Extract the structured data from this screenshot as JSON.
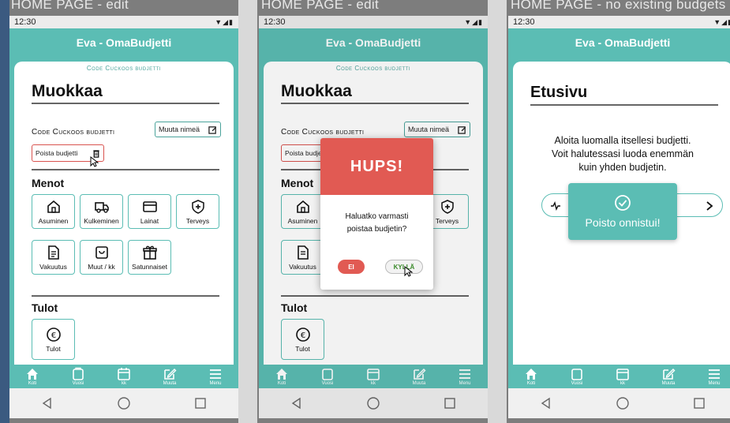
{
  "frames": [
    {
      "title": "HOME PAGE - edit"
    },
    {
      "title": "HOME PAGE - edit"
    },
    {
      "title": "HOME PAGE - no existing budgets"
    }
  ],
  "status": {
    "time": "12:30",
    "icons": "▼◢▮"
  },
  "app": {
    "title": "Eva - OmaBudjetti",
    "subtitle": "Code Cuckoos budjetti"
  },
  "edit": {
    "heading": "Muokkaa",
    "budget_name": "Code Cuckoos budjetti",
    "rename_label": "Muuta nimeä",
    "delete_label": "Poista budjetti",
    "expenses_heading": "Menot",
    "income_heading": "Tulot",
    "categories": [
      "Asuminen",
      "Kulkeminen",
      "Lainat",
      "Terveys",
      "Vakuutus",
      "Muut / kk",
      "Satunnaiset"
    ],
    "income_categories": [
      "Tulot"
    ]
  },
  "dialog": {
    "title": "HUPS!",
    "message_line1": "Haluatko varmasti",
    "message_line2": "poistaa budjetin?",
    "no_label": "EI",
    "yes_label": "KYLLÄ"
  },
  "home": {
    "heading": "Etusivu",
    "line1": "Aloita luomalla itsellesi budjetti.",
    "line2": "Voit halutessasi luoda enemmän",
    "line3": "kuin yhden budjetin.",
    "toast": "Poisto onnistui!"
  },
  "nav": {
    "items": [
      {
        "label": "Koti",
        "icon": "home-icon"
      },
      {
        "label": "Vuosi",
        "icon": "bag-icon"
      },
      {
        "label": "kk",
        "icon": "calendar-icon"
      },
      {
        "label": "Muuta",
        "icon": "edit-icon"
      },
      {
        "label": "Menu",
        "icon": "menu-icon"
      }
    ]
  },
  "colors": {
    "teal": "#5bbdb4",
    "red": "#e15a53",
    "white": "#ffffff"
  }
}
